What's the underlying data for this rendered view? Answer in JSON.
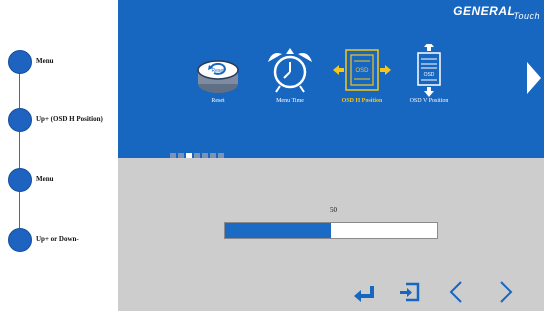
{
  "guide": {
    "steps": [
      {
        "label": "Menu"
      },
      {
        "label": "Up+ (OSD H Position)"
      },
      {
        "label": "Menu"
      },
      {
        "label": "Up+ or Down-"
      }
    ]
  },
  "brand": {
    "main": "GENERAL",
    "sub": "Touch"
  },
  "menu": {
    "items": [
      {
        "label": "Reset",
        "icon": "reset-icon",
        "badge": "Reset"
      },
      {
        "label": "Menu Time",
        "icon": "alarm-clock-icon"
      },
      {
        "label": "OSD H Position",
        "icon": "osd-h-position-icon",
        "badge": "OSD",
        "selected": true
      },
      {
        "label": "OSD V Position",
        "icon": "osd-v-position-icon",
        "badge": "OSD"
      }
    ],
    "page_count": 7,
    "active_page": 3
  },
  "slider": {
    "value": "50",
    "fraction": 0.5
  },
  "colors": {
    "accent": "#1766c0",
    "selected": "#f6c61a",
    "panel": "#cdcdcd"
  },
  "nav_icons": [
    "enter-icon",
    "exit-icon",
    "left-arrow-icon",
    "right-arrow-icon"
  ]
}
